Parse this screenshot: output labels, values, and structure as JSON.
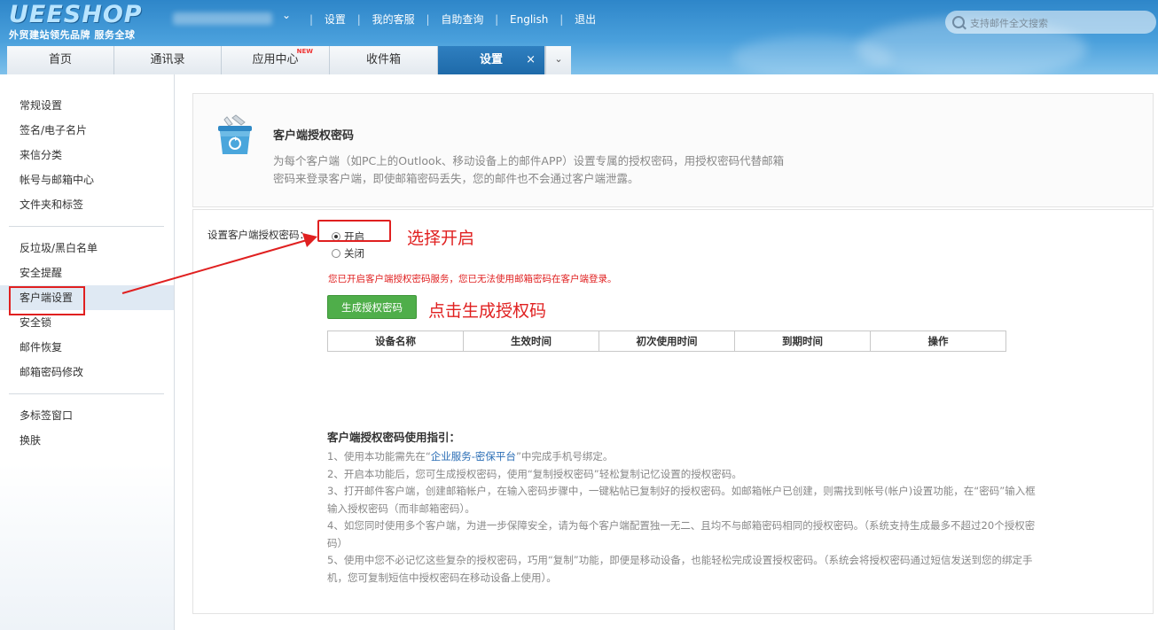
{
  "header": {
    "logo": "UEESHOP",
    "slogan": "外贸建站领先品牌 服务全球",
    "nav": [
      "设置",
      "我的客服",
      "自助查询",
      "English",
      "退出"
    ],
    "search_placeholder": "支持邮件全文搜索"
  },
  "tabs": [
    {
      "label": "首页"
    },
    {
      "label": "通讯录"
    },
    {
      "label": "应用中心",
      "badge": "NEW"
    },
    {
      "label": "收件箱"
    },
    {
      "label": "设置",
      "active": true
    }
  ],
  "sidebar": {
    "group1": [
      "常规设置",
      "签名/电子名片",
      "来信分类",
      "帐号与邮箱中心",
      "文件夹和标签"
    ],
    "group2": [
      "反垃圾/黑白名单",
      "安全提醒",
      "客户端设置",
      "安全锁",
      "邮件恢复",
      "邮箱密码修改"
    ],
    "group3": [
      "多标签窗口",
      "换肤"
    ],
    "active": "客户端设置"
  },
  "card": {
    "title": "客户端授权密码",
    "desc": "为每个客户端（如PC上的Outlook、移动设备上的邮件APP）设置专属的授权密码，用授权密码代替邮箱密码来登录客户端，即使邮箱密码丢失，您的邮件也不会通过客户端泄露。"
  },
  "form": {
    "label": "设置客户端授权密码：",
    "option_on": "开启",
    "option_off": "关闭",
    "selected": "开启",
    "warning": "您已开启客户端授权密码服务，您已无法使用邮箱密码在客户端登录。",
    "generate_button": "生成授权密码"
  },
  "annotations": {
    "select": "选择开启",
    "generate": "点击生成授权码"
  },
  "table": {
    "headers": [
      "设备名称",
      "生效时间",
      "初次使用时间",
      "到期时间",
      "操作"
    ]
  },
  "guide": {
    "title": "客户端授权密码使用指引：",
    "item1_pre": "1、使用本功能需先在“",
    "item1_link": "企业服务-密保平台",
    "item1_post": "”中完成手机号绑定。",
    "item2": "2、开启本功能后，您可生成授权密码，使用“复制授权密码”轻松复制记忆设置的授权密码。",
    "item3": "3、打开邮件客户端，创建邮箱帐户，在输入密码步骤中，一键粘帖已复制好的授权密码。如邮箱帐户已创建，则需找到帐号(帐户)设置功能，在“密码”输入框输入授权密码（而非邮箱密码）。",
    "item4": "4、如您同时使用多个客户端，为进一步保障安全，请为每个客户端配置独一无二、且均不与邮箱密码相同的授权密码。（系统支持生成最多不超过20个授权密码）",
    "item5": "5、使用中您不必记忆这些复杂的授权密码，巧用“复制”功能，即便是移动设备，也能轻松完成设置授权密码。（系统会将授权密码通过短信发送到您的绑定手机，您可复制短信中授权密码在移动设备上使用）。"
  }
}
